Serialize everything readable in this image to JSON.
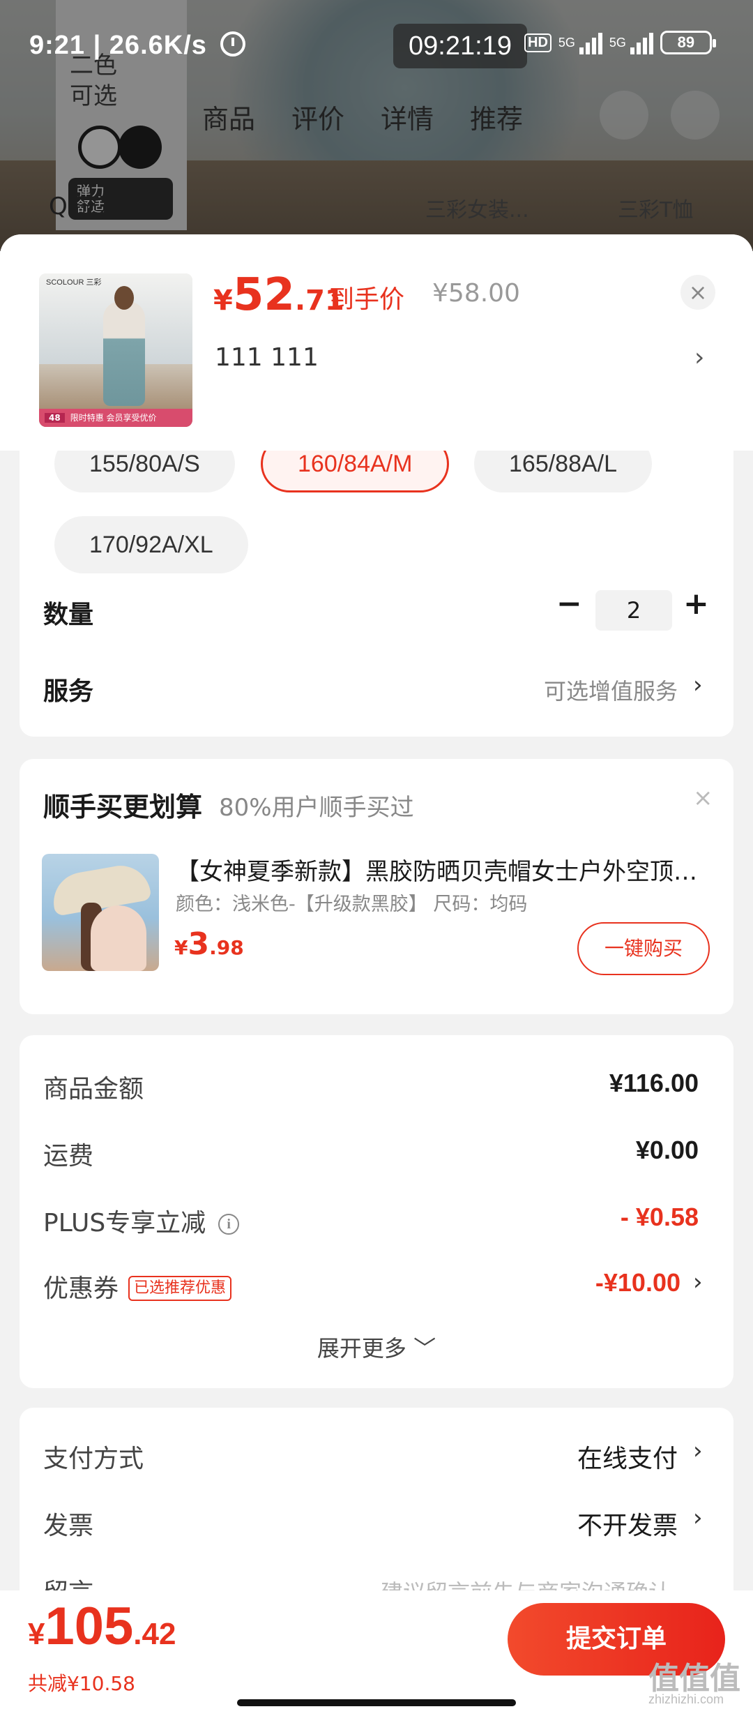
{
  "status_bar": {
    "left_text": "9:21 | 26.6K/s",
    "clock": "09:21:19",
    "hd": "HD",
    "net1": "5G",
    "net2": "5G",
    "battery": "89"
  },
  "background": {
    "thumb_text": "二色\n可选",
    "badge_text": "弹力\n舒适",
    "tabs": [
      "商品",
      "评价",
      "详情",
      "推荐"
    ],
    "search_text": "Q 三彩",
    "cat1": "三彩女装...",
    "cat2": "三彩T恤"
  },
  "header": {
    "price_currency": "¥",
    "price_int": "52",
    "price_dec": ".71",
    "price_tag": "到手价",
    "original_price": "¥58.00",
    "close_icon": "×",
    "product_title": "111  111",
    "chevron": "›",
    "image_brand": "SCOLOUR  三彩",
    "image_strip_num": "48",
    "image_strip_text": "限时特惠  会员享受优价"
  },
  "spec": {
    "sizes": [
      "155/80A/S",
      "160/84A/M",
      "165/88A/L",
      "170/92A/XL"
    ],
    "selected_size": "160/84A/M",
    "quantity_label": "数量",
    "minus": "−",
    "quantity": "2",
    "plus": "+",
    "service_label": "服务",
    "service_hint": "可选增值服务"
  },
  "bundle": {
    "title": "顺手买更划算",
    "subtitle": "80%用户顺手买过",
    "close_icon": "×",
    "item_title": "【女神夏季新款】黑胶防晒贝壳帽女士户外空顶遮阳帽",
    "item_spec": "颜色：浅米色-【升级款黑胶】   尺码：均码",
    "price_currency": "¥",
    "price_int": "3",
    "price_dec": ".98",
    "buy_label": "一键购买"
  },
  "amounts": {
    "goods_label": "商品金额",
    "goods_value": "¥116.00",
    "shipping_label": "运费",
    "shipping_value": "¥0.00",
    "plus_label": "PLUS专享立减",
    "plus_value": "- ¥0.58",
    "coupon_label": "优惠券",
    "coupon_tag": "已选推荐优惠",
    "coupon_value": "-¥10.00",
    "expand_label": "展开更多 ﹀"
  },
  "payment": {
    "method_label": "支付方式",
    "method_value": "在线支付",
    "invoice_label": "发票",
    "invoice_value": "不开发票",
    "note_label": "留言",
    "note_hint": "建议留言前先与商家沟通确认"
  },
  "footer": {
    "total_currency": "¥",
    "total_int": "105",
    "total_dec": ".42",
    "saved": "共减¥10.58",
    "submit_label": "提交订单",
    "watermark": "值值值",
    "watermark_url": "zhizhizhi.com"
  },
  "colors": {
    "accent": "#e8321e",
    "muted": "#888888"
  }
}
